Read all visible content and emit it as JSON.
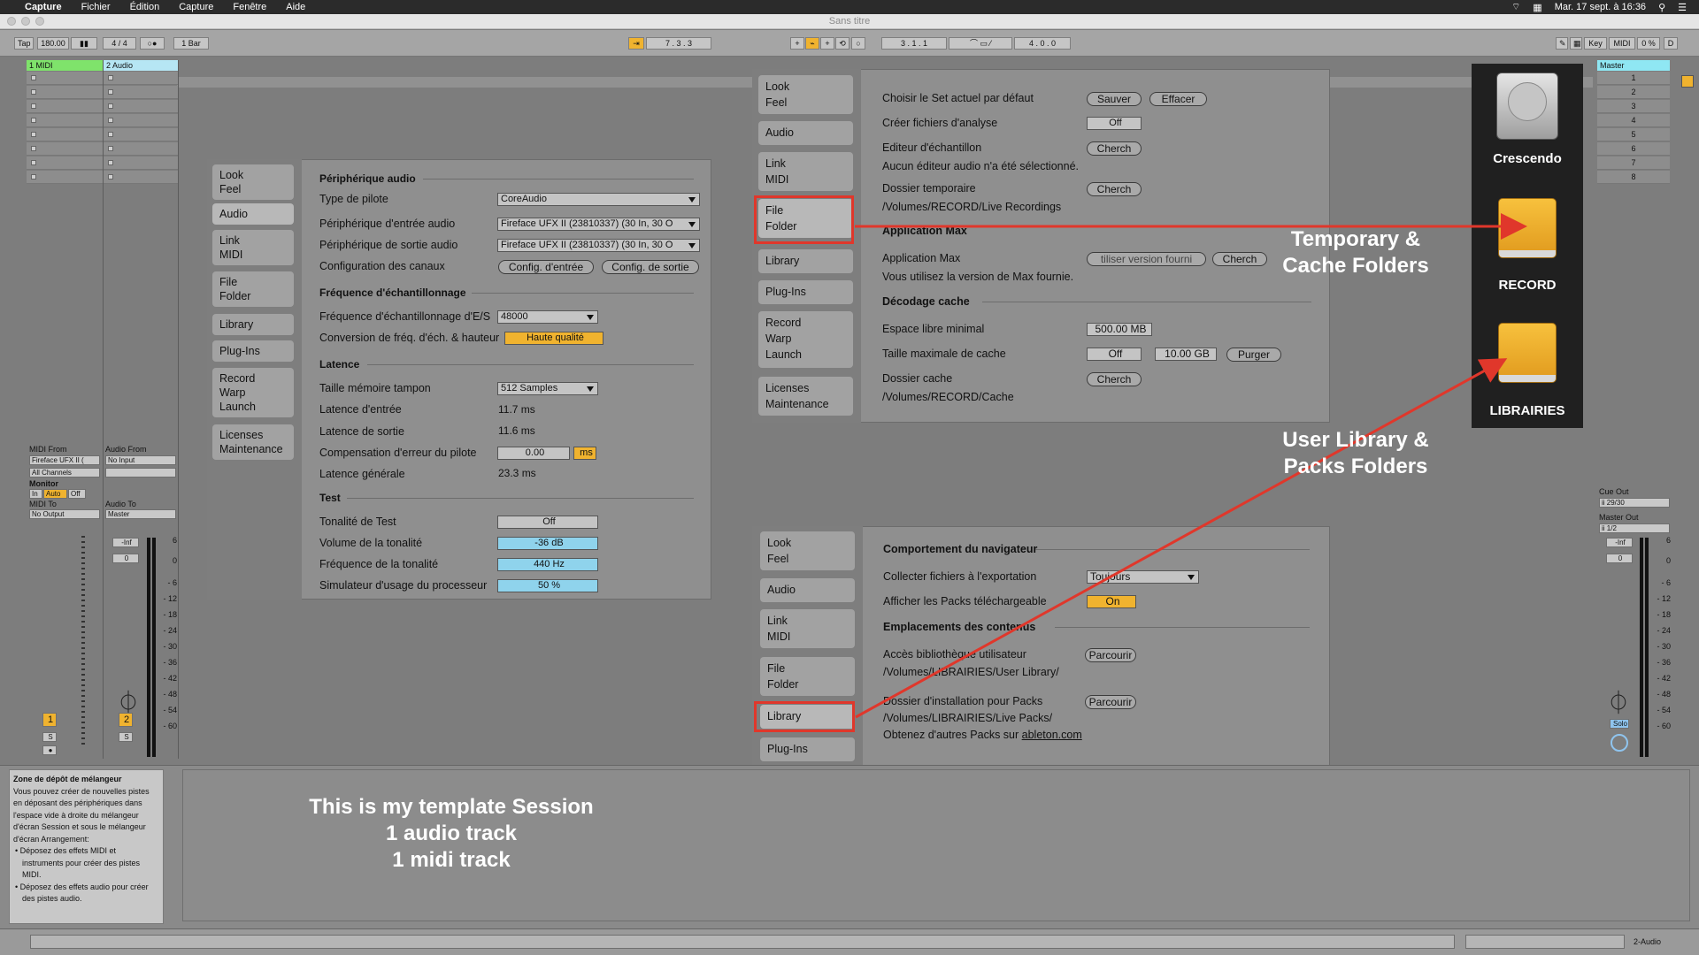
{
  "menubar": {
    "app": "Capture",
    "menus": [
      "Fichier",
      "Édition",
      "Capture",
      "Fenêtre",
      "Aide"
    ],
    "datetime": "Mar. 17 sept. à 16:36"
  },
  "window_title": "Sans titre",
  "control_bar": {
    "tap": "Tap",
    "tempo": "180.00",
    "signature": "4 / 4",
    "metro": "1 Bar",
    "arr_pos": "7 .   3 .   3",
    "loop_start": "3 .   1 .   1",
    "loop_len": "4 .   0 .   0",
    "key": "Key",
    "midi": "MIDI",
    "cpu": "0 %",
    "d": "D"
  },
  "tracks": {
    "midi_name": "1 MIDI",
    "audio_name": "2 Audio",
    "master_name": "Master",
    "scenes": [
      "1",
      "2",
      "3",
      "4",
      "5",
      "6",
      "7",
      "8"
    ],
    "midi_from_label": "MIDI From",
    "midi_from_value": "Fireface UFX II (",
    "midi_channel": "All Channels",
    "monitor_label": "Monitor",
    "monitor_in": "In",
    "monitor_auto": "Auto",
    "monitor_off": "Off",
    "midi_to_label": "MIDI To",
    "midi_to_value": "No Output",
    "audio_from_label": "Audio From",
    "audio_from_value": "No Input",
    "audio_to_label": "Audio To",
    "audio_to_value": "Master",
    "cue_out_label": "Cue Out",
    "cue_out_value": "ii 29/30",
    "master_out_label": "Master Out",
    "master_out_value": "ii 1/2",
    "vol_inf": "-Inf",
    "vol_zero": "0",
    "track1_num": "1",
    "track2_num": "2",
    "solo_s": "S",
    "solo_master": "Solo",
    "scale": [
      "6",
      "0",
      "6",
      "12",
      "18",
      "24",
      "30",
      "36",
      "42",
      "48",
      "54",
      "60"
    ],
    "scale_neg": [
      "6",
      "0",
      "- 6",
      "- 12",
      "- 18",
      "- 24",
      "- 30",
      "- 36",
      "- 42",
      "- 48",
      "- 54",
      "- 60"
    ]
  },
  "nav_tabs": [
    "Look\nFeel",
    "Audio",
    "Link\nMIDI",
    "File\nFolder",
    "Library",
    "Plug-Ins",
    "Record\nWarp\nLaunch",
    "Licenses\nMaintenance"
  ],
  "audio_prefs": {
    "sec_device": "Périphérique audio",
    "driver_type_label": "Type de pilote",
    "driver_type_value": "CoreAudio",
    "input_device_label": "Périphérique d'entrée audio",
    "input_device_value": "Fireface UFX II (23810337) (30 In, 30 O",
    "output_device_label": "Périphérique de sortie audio",
    "output_device_value": "Fireface UFX II (23810337) (30 In, 30 O",
    "channels_label": "Configuration des canaux",
    "input_config_btn": "Config. d'entrée",
    "output_config_btn": "Config. de sortie",
    "sec_samplerate": "Fréquence d'échantillonnage",
    "sr_label": "Fréquence d'échantillonnage d'E/S",
    "sr_value": "48000",
    "conv_label": "Conversion de fréq. d'éch. & hauteur",
    "conv_value": "Haute qualité",
    "sec_latency": "Latence",
    "buffer_label": "Taille mémoire tampon",
    "buffer_value": "512 Samples",
    "in_lat_label": "Latence d'entrée",
    "in_lat_value": "11.7 ms",
    "out_lat_label": "Latence de sortie",
    "out_lat_value": "11.6 ms",
    "comp_label": "Compensation d'erreur du pilote",
    "comp_value": "0.00",
    "comp_unit": "ms",
    "total_label": "Latence générale",
    "total_value": "23.3 ms",
    "sec_test": "Test",
    "tone_label": "Tonalité de Test",
    "tone_value": "Off",
    "tone_vol_label": "Volume de la tonalité",
    "tone_vol_value": "-36 dB",
    "tone_freq_label": "Fréquence de la tonalité",
    "tone_freq_value": "440 Hz",
    "cpu_sim_label": "Simulateur d'usage du processeur",
    "cpu_sim_value": "50 %"
  },
  "file_prefs": {
    "default_set_label": "Choisir le Set actuel par défaut",
    "save_btn": "Sauver",
    "clear_btn": "Effacer",
    "analysis_label": "Créer fichiers d'analyse",
    "analysis_value": "Off",
    "sample_editor_label": "Editeur d'échantillon",
    "browse_btn": "Cherch",
    "no_editor_text": "Aucun éditeur audio n'a été sélectionné.",
    "temp_folder_label": "Dossier temporaire",
    "temp_folder_path": "/Volumes/RECORD/Live Recordings",
    "sec_max": "Application Max",
    "max_app_label": "Application Max",
    "max_app_value": "tiliser version fourni",
    "max_info": "Vous utilisez la version de Max fournie.",
    "sec_cache": "Décodage cache",
    "min_space_label": "Espace libre minimal",
    "min_space_value": "500.00 MB",
    "max_cache_label": "Taille maximale de cache",
    "max_cache_off": "Off",
    "max_cache_value": "10.00 GB",
    "purge_btn": "Purger",
    "cache_folder_label": "Dossier cache",
    "cache_folder_path": "/Volumes/RECORD/Cache"
  },
  "library_prefs": {
    "sec_browser": "Comportement du navigateur",
    "collect_label": "Collecter fichiers à l'exportation",
    "collect_value": "Toujours",
    "show_packs_label": "Afficher les Packs téléchargeable",
    "show_packs_value": "On",
    "sec_locations": "Emplacements des contenus",
    "user_lib_label": "Accès bibliothèque utilisateur",
    "user_lib_path": "/Volumes/LIBRAIRIES/User Library/",
    "browse_btn": "Parcourir",
    "packs_label": "Dossier d'installation pour Packs",
    "packs_path": "/Volumes/LIBRAIRIES/Live Packs/",
    "more_packs_text": "Obtenez d'autres Packs sur",
    "more_packs_link": "ableton.com"
  },
  "drives": [
    "Crescendo",
    "RECORD",
    "LIBRAIRIES"
  ],
  "annotations": {
    "temp_cache": "Temporary &\nCache Folders",
    "user_lib": "User Library &\nPacks Folders",
    "template": "This is my template Session\n1 audio track\n1 midi track"
  },
  "drop_zone": {
    "title": "Zone de dépôt de mélangeur",
    "body": "Vous pouvez créer de nouvelles pistes en déposant des périphériques dans l'espace vide à droite du mélangeur d'écran Session et sous le mélangeur d'écran Arrangement:",
    "bullet1": "Déposez des effets MIDI et instruments pour créer des pistes MIDI.",
    "bullet2": "Déposez des effets audio pour créer des pistes audio."
  },
  "status_bar": {
    "selected_track": "2-Audio"
  },
  "colors": {
    "accent_orange": "#f0b32f",
    "midi_track": "#7fe36b",
    "audio_track": "#b6e6f4",
    "master_track": "#8fe7f3",
    "annotation_red": "#e0372b",
    "drive_orange": "#f2b02e"
  }
}
